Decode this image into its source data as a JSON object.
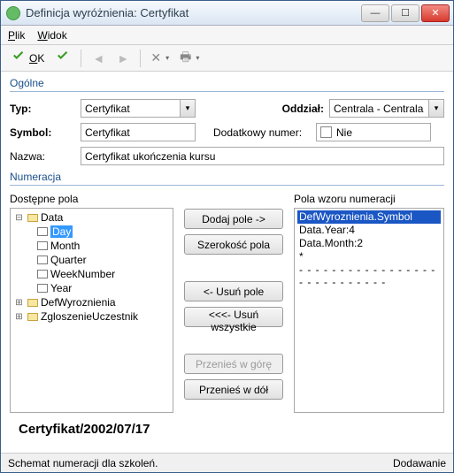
{
  "window": {
    "title": "Definicja wyróżnienia: Certyfikat"
  },
  "menu": {
    "plik": "Plik",
    "widok": "Widok"
  },
  "toolbar": {
    "ok": "OK"
  },
  "sections": {
    "ogolne": "Ogólne",
    "numeracja": "Numeracja"
  },
  "form": {
    "typ_label": "Typ:",
    "typ_value": "Certyfikat",
    "oddzial_label": "Oddział:",
    "oddzial_value": "Centrala - Centrala",
    "symbol_label": "Symbol:",
    "symbol_value": "Certyfikat",
    "dodnum_label": "Dodatkowy numer:",
    "dodnum_value": "Nie",
    "nazwa_label": "Nazwa:",
    "nazwa_value": "Certyfikat ukończenia kursu"
  },
  "num": {
    "available_label": "Dostępne pola",
    "pattern_label": "Pola wzoru numeracji",
    "tree": {
      "root": "Data",
      "children": [
        "Day",
        "Month",
        "Quarter",
        "WeekNumber",
        "Year"
      ],
      "selected": "Day",
      "siblings": [
        "DefWyroznienia",
        "ZgloszenieUczestnik"
      ]
    },
    "buttons": {
      "add": "Dodaj pole ->",
      "width": "Szerokość pola",
      "remove": "<- Usuń pole",
      "remove_all": "<<<- Usuń wszystkie",
      "up": "Przenieś w górę",
      "down": "Przenieś w dół"
    },
    "pattern_items": [
      "DefWyroznienia.Symbol",
      "Data.Year:4",
      "Data.Month:2",
      "*"
    ],
    "pattern_selected": 0,
    "dots": "- - - - - - - - - - - - - - - - - - - - - - - - - - - -"
  },
  "preview": "Certyfikat/2002/07/17",
  "status": {
    "left": "Schemat numeracji dla szkoleń.",
    "right": "Dodawanie"
  }
}
